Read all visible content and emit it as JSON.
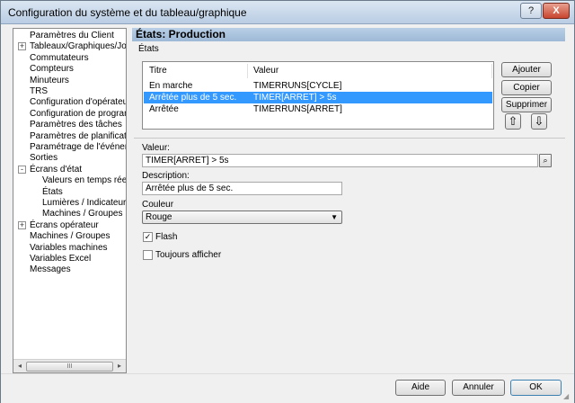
{
  "window": {
    "title": "Configuration du système et du tableau/graphique",
    "help_label": "?",
    "close_label": "X"
  },
  "tree": {
    "items": [
      {
        "label": "Paramètres du Client",
        "level": 0,
        "expander": ""
      },
      {
        "label": "Tableaux/Graphiques/Journa",
        "level": 0,
        "expander": "+"
      },
      {
        "label": "Commutateurs",
        "level": 0,
        "expander": ""
      },
      {
        "label": "Compteurs",
        "level": 0,
        "expander": ""
      },
      {
        "label": "Minuteurs",
        "level": 0,
        "expander": ""
      },
      {
        "label": "TRS",
        "level": 0,
        "expander": ""
      },
      {
        "label": "Configuration d'opérateur",
        "level": 0,
        "expander": ""
      },
      {
        "label": "Configuration de programme",
        "level": 0,
        "expander": ""
      },
      {
        "label": "Paramètres des tâches",
        "level": 0,
        "expander": ""
      },
      {
        "label": "Paramètres de planification",
        "level": 0,
        "expander": ""
      },
      {
        "label": "Paramétrage de l'événement",
        "level": 0,
        "expander": ""
      },
      {
        "label": "Sorties",
        "level": 0,
        "expander": ""
      },
      {
        "label": "Écrans d'état",
        "level": 0,
        "expander": "-"
      },
      {
        "label": "Valeurs en temps réel",
        "level": 1,
        "expander": ""
      },
      {
        "label": "États",
        "level": 1,
        "expander": ""
      },
      {
        "label": "Lumières / Indicateurs",
        "level": 1,
        "expander": ""
      },
      {
        "label": "Machines / Groupes",
        "level": 1,
        "expander": ""
      },
      {
        "label": "Écrans opérateur",
        "level": 0,
        "expander": "+"
      },
      {
        "label": "Machines / Groupes",
        "level": 0,
        "expander": ""
      },
      {
        "label": "Variables machines",
        "level": 0,
        "expander": ""
      },
      {
        "label": "Variables Excel",
        "level": 0,
        "expander": ""
      },
      {
        "label": "Messages",
        "level": 0,
        "expander": ""
      }
    ],
    "scroll_left": "◂",
    "scroll_right": "▸",
    "scroll_grip": "III"
  },
  "panel": {
    "header": "États: Production",
    "group_label": "États",
    "list": {
      "columns": [
        "Titre",
        "Valeur"
      ],
      "rows": [
        {
          "title": "En marche",
          "value": "TIMERRUNS[CYCLE]",
          "selected": false
        },
        {
          "title": "Arrêtée plus de 5 sec.",
          "value": "TIMER[ARRET] > 5s",
          "selected": true
        },
        {
          "title": "Arrêtée",
          "value": "TIMERRUNS[ARRET]",
          "selected": false
        }
      ]
    },
    "buttons": {
      "add": "Ajouter",
      "copy": "Copier",
      "delete": "Supprimer",
      "up": "⇧",
      "down": "⇩"
    },
    "value_label": "Valeur:",
    "value": "TIMER[ARRET] > 5s",
    "description_label": "Description:",
    "description": "Arrêtée plus de 5 sec.",
    "color_label": "Couleur",
    "color": "Rouge",
    "color_arrow": "▼",
    "flash_label": "Flash",
    "flash_checked": true,
    "flash_mark": "✓",
    "always_label": "Toujours afficher",
    "always_checked": false
  },
  "footer": {
    "help": "Aide",
    "cancel": "Annuler",
    "ok": "OK"
  },
  "colors": {
    "selection": "#3399ff",
    "header": "#b9cfe6"
  }
}
